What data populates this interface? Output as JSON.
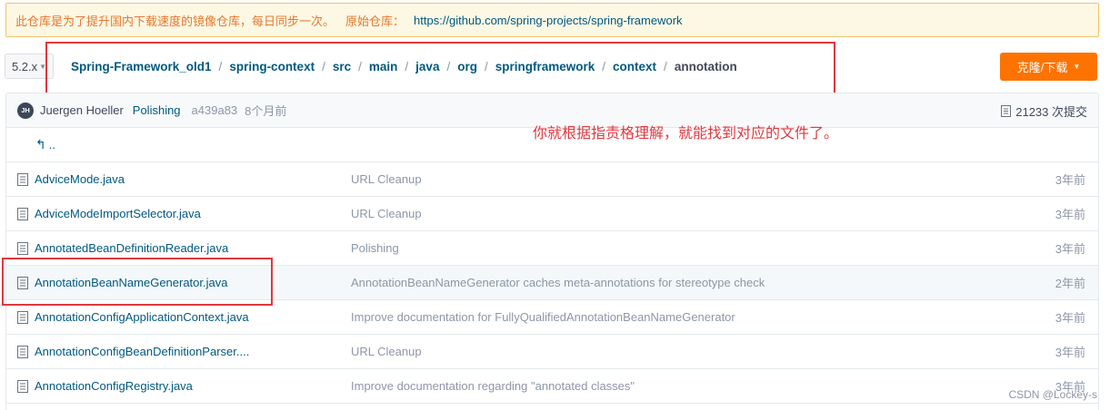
{
  "mirror_notice": {
    "text": "此仓库是为了提升国内下载速度的镜像仓库，每日同步一次。",
    "origin_label": "原始仓库：",
    "origin_url": "https://github.com/spring-projects/spring-framework"
  },
  "branch": {
    "value": "5.2.x",
    "icon": "chevron-down-icon"
  },
  "breadcrumb": {
    "segments": [
      "Spring-Framework_old1",
      "spring-context",
      "src",
      "main",
      "java",
      "org",
      "springframework",
      "context"
    ],
    "current": "annotation",
    "separator": "/"
  },
  "clone_button": {
    "label": "克隆/下载",
    "icon": "chevron-down-icon",
    "color": "#fe7300"
  },
  "latest_commit": {
    "avatar_initials": "JH",
    "author": "Juergen Hoeller",
    "message": "Polishing",
    "sha": "a439a83",
    "time": "8个月前",
    "count": "21233 次提交"
  },
  "annotation_note": "你就根据指责格理解，就能找到对应的文件了。",
  "parent_dir": {
    "label": "..",
    "icon": "arrow-back-icon"
  },
  "files": [
    {
      "name": "AdviceMode.java",
      "message": "URL Cleanup",
      "time": "3年前"
    },
    {
      "name": "AdviceModeImportSelector.java",
      "message": "URL Cleanup",
      "time": "3年前"
    },
    {
      "name": "AnnotatedBeanDefinitionReader.java",
      "message": "Polishing",
      "time": "3年前"
    },
    {
      "name": "AnnotationBeanNameGenerator.java",
      "message": "AnnotationBeanNameGenerator caches meta-annotations for stereotype check",
      "time": "2年前"
    },
    {
      "name": "AnnotationConfigApplicationContext.java",
      "message": "Improve documentation for FullyQualifiedAnnotationBeanNameGenerator",
      "time": "3年前"
    },
    {
      "name": "AnnotationConfigBeanDefinitionParser....",
      "message": "URL Cleanup",
      "time": "3年前"
    },
    {
      "name": "AnnotationConfigRegistry.java",
      "message": "Improve documentation regarding \"annotated classes\"",
      "time": "3年前"
    }
  ],
  "watermark": "CSDN @Lockey-s",
  "colors": {
    "annotation_red": "#e0383e",
    "link_blue": "#005980",
    "notice_orange": "#e8772e"
  }
}
